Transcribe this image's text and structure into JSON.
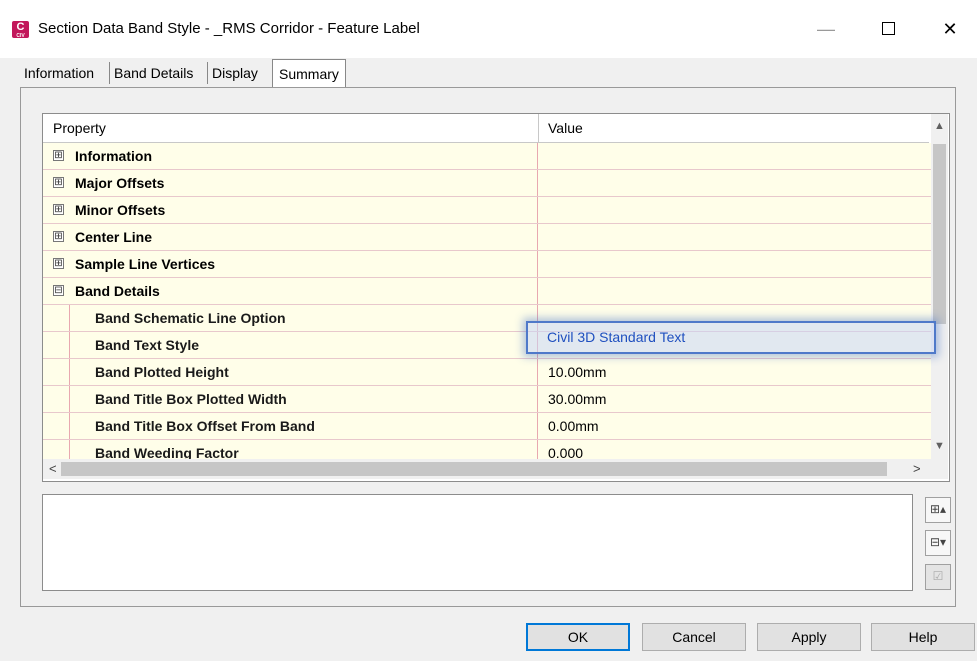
{
  "window": {
    "title": "Section Data Band Style - _RMS Corridor - Feature Label",
    "app_icon": "civil-3d-icon",
    "controls": [
      "minimize",
      "maximize",
      "close"
    ]
  },
  "tabs": [
    {
      "label": "Information"
    },
    {
      "label": "Band Details"
    },
    {
      "label": "Display"
    },
    {
      "label": "Summary",
      "active": true
    }
  ],
  "grid": {
    "header": {
      "property": "Property",
      "value": "Value"
    },
    "categories": [
      {
        "label": "Information",
        "expander": "⊞"
      },
      {
        "label": "Major Offsets",
        "expander": "⊞"
      },
      {
        "label": "Minor Offsets",
        "expander": "⊞"
      },
      {
        "label": "Center Line",
        "expander": "⊞"
      },
      {
        "label": "Sample Line Vertices",
        "expander": "⊞"
      },
      {
        "label": "Band Details",
        "expander": "⊟"
      }
    ],
    "band_details_rows": [
      {
        "property": "Band Schematic Line Option",
        "value": ""
      },
      {
        "property": "Band Text Style",
        "value": "Civil 3D Standard Text"
      },
      {
        "property": "Band Plotted Height",
        "value": "10.00mm"
      },
      {
        "property": "Band Title Box Plotted Width",
        "value": "30.00mm"
      },
      {
        "property": "Band Title Box Offset From Band",
        "value": "0.00mm"
      },
      {
        "property": "Band Weeding Factor",
        "value": "0.000"
      }
    ],
    "highlight_color": "#4f79c9"
  },
  "buttons": {
    "ok": "OK",
    "cancel": "Cancel",
    "apply": "Apply",
    "help": "Help"
  }
}
